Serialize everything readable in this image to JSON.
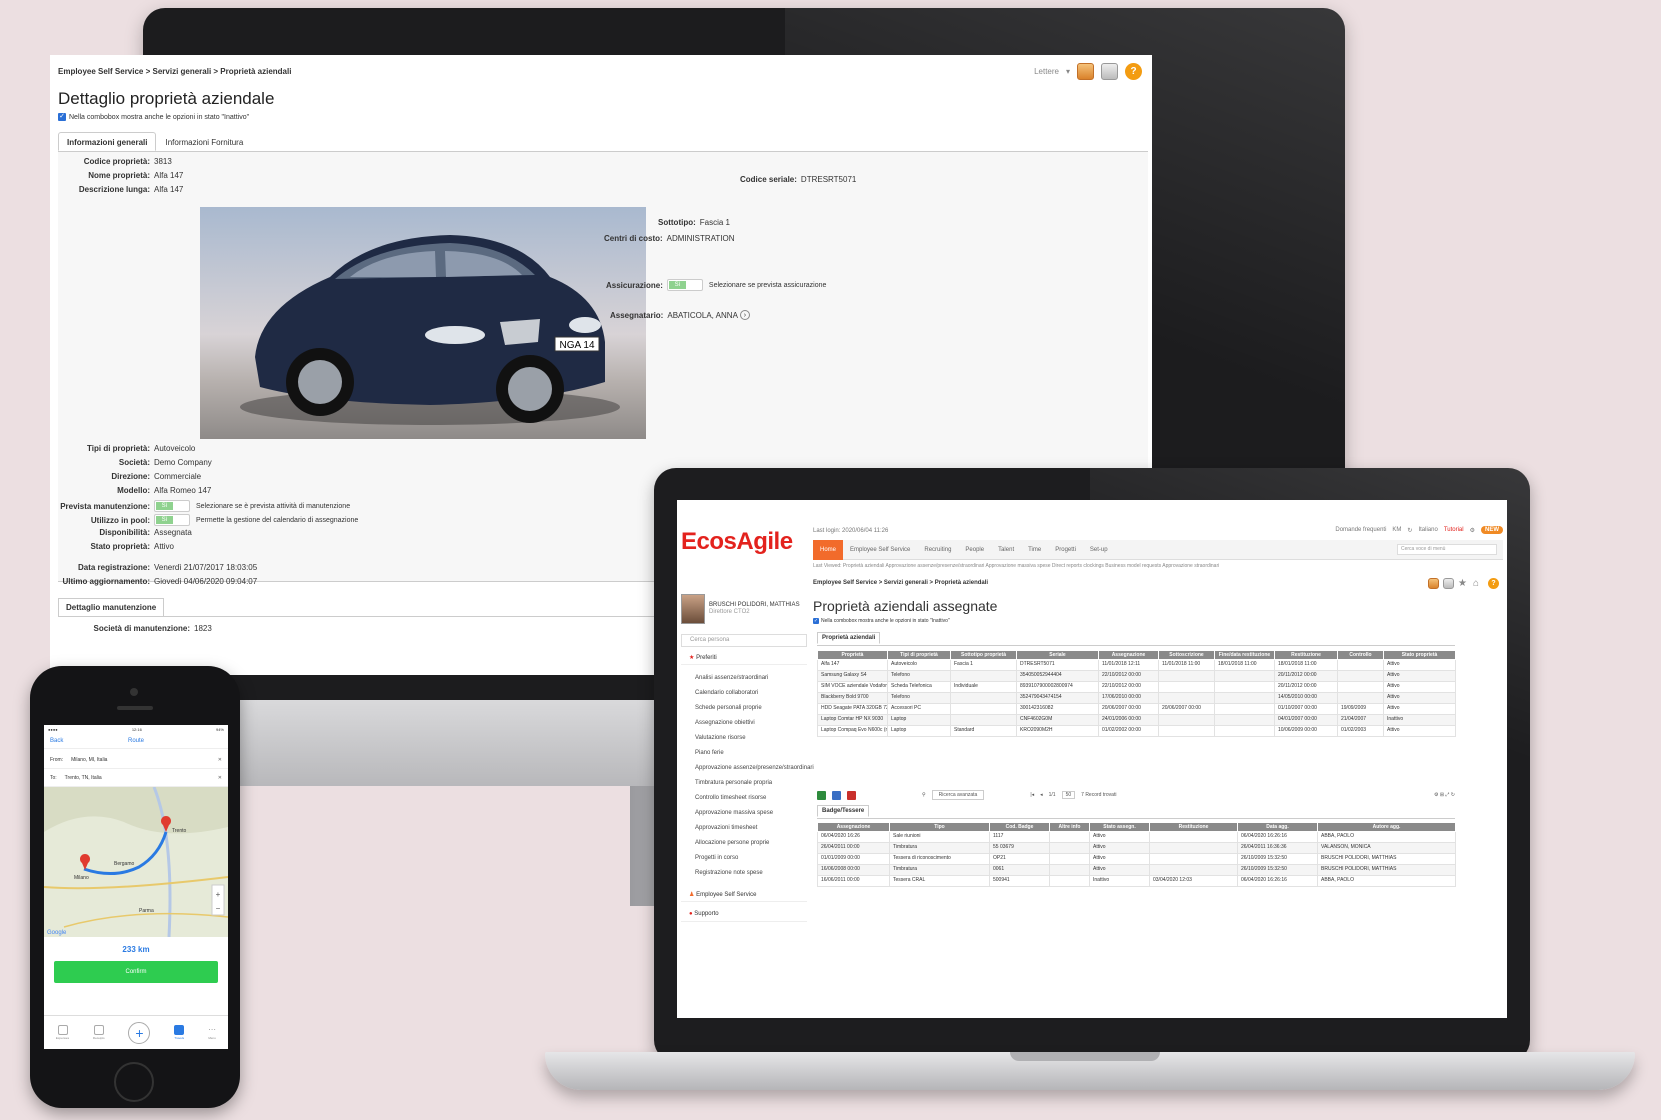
{
  "monitor": {
    "breadcrumb": "Employee Self Service > Servizi generali > Proprietà aziendali",
    "tools_label": "Lettere",
    "title": "Dettaglio proprietà aziendale",
    "inactive_check": "Nella combobox mostra anche le opzioni in stato \"Inattivo\"",
    "tabs": [
      "Informazioni generali",
      "Informazioni Fornitura"
    ],
    "fields": {
      "codice_label": "Codice proprietà:",
      "codice": "3813",
      "nome_label": "Nome proprietà:",
      "nome": "Alfa 147",
      "descr_label": "Descrizione lunga:",
      "descr": "Alfa 147",
      "seriale_label": "Codice seriale:",
      "seriale": "DTRESRT5071",
      "sottotipo_label": "Sottotipo:",
      "sottotipo": "Fascia 1",
      "centri_label": "Centri di costo:",
      "centri": "ADMINISTRATION",
      "assic_label": "Assicurazione:",
      "assic_toggle": "Sì",
      "assic_hint": "Selezionare se prevista assicurazione",
      "assegn_label": "Assegnatario:",
      "assegn": "ABATICOLA, ANNA",
      "tipi_label": "Tipi di proprietà:",
      "tipi": "Autoveicolo",
      "societa_label": "Società:",
      "societa": "Demo Company",
      "direzione_label": "Direzione:",
      "direzione": "Commerciale",
      "modello_label": "Modello:",
      "modello": "Alfa Romeo 147",
      "manut_label": "Prevista manutenzione:",
      "manut_toggle": "Sì",
      "manut_hint": "Selezionare se è prevista attività di manutenzione",
      "pool_label": "Utilizzo in pool:",
      "pool_toggle": "Sì",
      "pool_hint": "Permette la gestione del calendario di assegnazione",
      "disp_label": "Disponibilità:",
      "disp": "Assegnata",
      "stato_label": "Stato proprietà:",
      "stato": "Attivo",
      "datareg_label": "Data registrazione:",
      "datareg": "Venerdì 21/07/2017 18:03:05",
      "ultagg_label": "Ultimo aggiornamento:",
      "ultagg": "Giovedì 04/06/2020 09:04:07"
    },
    "plate": "NGA 14",
    "manut_tab": "Dettaglio manutenzione",
    "soc_manut_label": "Società di manutenzione:",
    "soc_manut": "1823"
  },
  "laptop": {
    "logo": "EcosAgile",
    "last_login": "Last login: 2020/06/04 11:26",
    "top_right": [
      "Domande frequenti",
      "KM",
      "Italiano",
      "Tutorial",
      "NEW"
    ],
    "user_name": "BRUSCHI POLIDORI, MATTHIAS",
    "user_role": "Direttore CTO2",
    "search_placeholder": "Cerca persona",
    "nav": [
      "Home",
      "Employee Self Service",
      "Recruiting",
      "People",
      "Talent",
      "Time",
      "Progetti",
      "Set-up"
    ],
    "nav_search": "Cerca voce di menù",
    "sub": "Last Viewed: Proprietà aziendali   Approvazione assenze/presenze/straordinari   Approvazione massiva spese   Direct reports clockings   Business model requests   Approvazione straordinari",
    "breadcrumb": "Employee Self Service > Servizi generali > Proprietà aziendali",
    "title": "Proprietà aziendali assegnate",
    "check": "Nella combobox mostra anche le opzioni in stato \"Inattivo\"",
    "sidebar": {
      "preferiti": "Preferiti",
      "items": [
        "Analisi assenze/straordinari",
        "Calendario collaboratori",
        "Schede personali proprie",
        "Assegnazione obiettivi",
        "Valutazione risorse",
        "Piano ferie",
        "Approvazione assenze/presenze/straordinari",
        "Timbratura personale propria",
        "Controllo timesheet risorse",
        "Approvazione massiva spese",
        "Approvazioni timesheet",
        "Allocazione persone proprie",
        "Progetti in corso",
        "Registrazione note spese"
      ],
      "ess": "Employee Self Service",
      "supporto": "Supporto"
    },
    "t1_tab": "Proprietà aziendali",
    "t1_headers": [
      "Proprietà",
      "Tipi di proprietà",
      "Sottotipo proprietà",
      "Seriale",
      "Assegnazione",
      "Sottoscrizione",
      "Fine/data restituzione",
      "Restituzione",
      "Controllo",
      "Stato proprietà"
    ],
    "t1_rows": [
      [
        "Alfa 147",
        "Autoveicolo",
        "Fascia 1",
        "DTRESRT5071",
        "11/01/2018 12:11",
        "11/01/2018 11:00",
        "18/01/2018 11:00",
        "18/01/2018 11:00",
        "",
        "Attivo"
      ],
      [
        "Samsung Galaxy S4",
        "Telefono",
        "",
        "354050052944404",
        "22/10/2012 00:00",
        "",
        "",
        "20/11/2012 00:00",
        "",
        "Attivo"
      ],
      [
        "SIM VOCE aziendale Vodafone",
        "Scheda Telefonica",
        "Individuale",
        "8939107900002800974",
        "22/10/2012 00:00",
        "",
        "",
        "20/11/2012 00:00",
        "",
        "Attivo"
      ],
      [
        "Blackberry Bold 9700",
        "Telefono",
        "",
        "352479043474154",
        "17/06/2010 00:00",
        "",
        "",
        "14/05/2010 00:00",
        "",
        "Attivo"
      ],
      [
        "HDD Seagate PATA 320GB 7200RPM",
        "Accessori PC",
        "",
        "300142316082",
        "20/06/2007 00:00",
        "20/06/2007 00:00",
        "",
        "01/10/2007 00:00",
        "19/09/2009",
        "Attivo"
      ],
      [
        "Laptop Comtar HP NX 9030",
        "Laptop",
        "",
        "CNF4602G0M",
        "24/01/2006 00:00",
        "",
        "",
        "04/01/2007 00:00",
        "21/04/2007",
        "Inattivo"
      ],
      [
        "Laptop Compaq Evo N600c (mutello)",
        "Laptop",
        "Standard",
        "KRO2090M2H",
        "01/02/2002 00:00",
        "",
        "",
        "10/06/2009 00:00",
        "01/02/2003",
        "Attivo"
      ]
    ],
    "pager": {
      "advanced": "Ricerca avanzata",
      "page_size": "50",
      "records": "7 Record trovati",
      "page": "1/1"
    },
    "t2_tab": "Badge/Tessere",
    "t2_headers": [
      "Assegnazione",
      "Tipo",
      "Cod. Badge",
      "Altre info",
      "Stato assegn.",
      "Restituzione",
      "Data agg.",
      "Autore agg."
    ],
    "t2_rows": [
      [
        "06/04/2020 16:26",
        "Sale riunioni",
        "1117",
        "",
        "Attivo",
        "",
        "06/04/2020 16:26:16",
        "ABBA, PAOLO"
      ],
      [
        "26/04/2011 00:00",
        "Timbratura",
        "55 03679",
        "",
        "Attivo",
        "",
        "26/04/2011 16:36:36",
        "VALANSON, MONICA"
      ],
      [
        "01/01/2009 00:00",
        "Tessera di riconoscimento",
        "OP21",
        "",
        "Attivo",
        "",
        "26/10/2009 15:32:50",
        "BRUSCHI POLIDORI, MATTHIAS"
      ],
      [
        "16/06/2008 00:00",
        "Timbratura",
        "0061",
        "",
        "Attivo",
        "",
        "26/10/2009 15:32:50",
        "BRUSCHI POLIDORI, MATTHIAS"
      ],
      [
        "16/06/2011 00:00",
        "Tessera CRAL",
        "500941",
        "",
        "Inattivo",
        "03/04/2020 12:03",
        "06/04/2020 16:26:16",
        "ABBA, PAOLO"
      ]
    ]
  },
  "phone": {
    "time": "12:16",
    "battery": "94%",
    "back": "Back",
    "nav_title": "Route",
    "from_label": "From:",
    "from": "Milano, MI, Italia",
    "to_label": "To:",
    "to": "Trento, TN, Italia",
    "distance": "233 km",
    "confirm": "Confirm",
    "map_labels": [
      "Milano",
      "Trento",
      "Bergamo",
      "Parma",
      "Google"
    ],
    "tabs": [
      "Expenses",
      "Receipts",
      "",
      "Travels",
      "Menu"
    ]
  }
}
